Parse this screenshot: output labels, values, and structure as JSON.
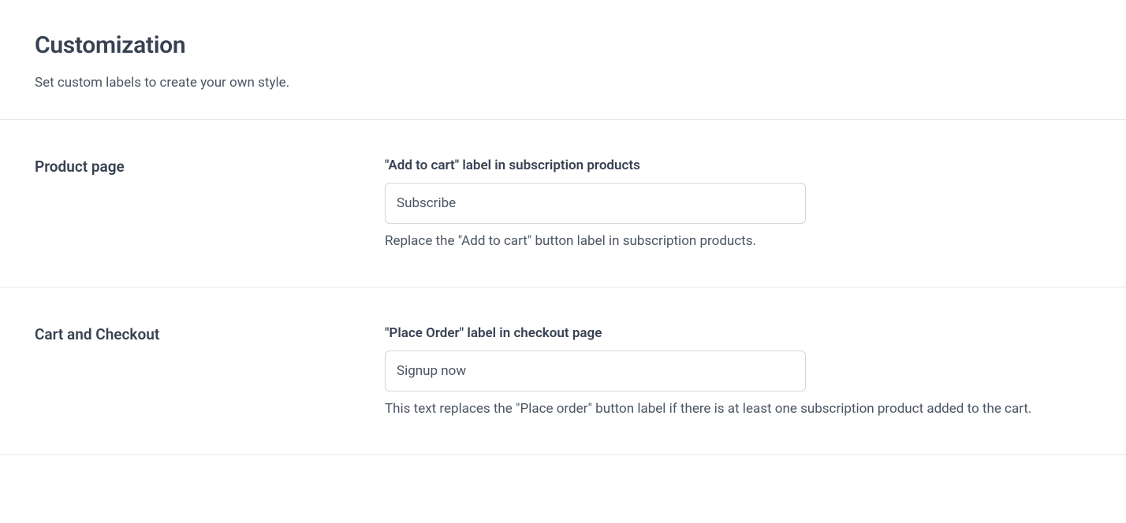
{
  "header": {
    "title": "Customization",
    "subtitle": "Set custom labels to create your own style."
  },
  "sections": {
    "product_page": {
      "title": "Product page",
      "field_label": "\"Add to cart\" label in subscription products",
      "field_value": "Subscribe",
      "field_help": "Replace the \"Add to cart\" button label in subscription products."
    },
    "cart_checkout": {
      "title": "Cart and Checkout",
      "field_label": "\"Place Order\" label in checkout page",
      "field_value": "Signup now",
      "field_help": "This text replaces the \"Place order\" button label if there is at least one subscription product added to the cart."
    }
  }
}
